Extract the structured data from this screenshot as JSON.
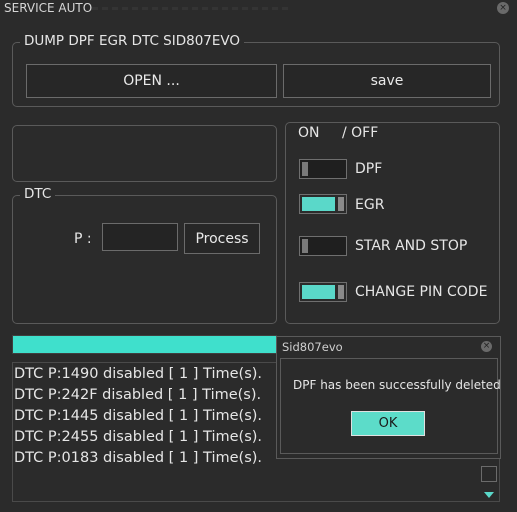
{
  "window": {
    "title": "SERVICE  AUTO"
  },
  "dump_group": {
    "legend": "DUMP   DPF   EGR   DTC   SID807EVO",
    "open_label": "OPEN ...",
    "save_label": "save"
  },
  "dtc_group": {
    "legend": "DTC",
    "p_label": "P :",
    "p_value": "",
    "process_label": "Process"
  },
  "onoff_group": {
    "on_label": "ON",
    "off_label": "/ OFF",
    "toggles": [
      {
        "label": "DPF",
        "state": "off"
      },
      {
        "label": "EGR",
        "state": "on"
      },
      {
        "label": "STAR AND STOP",
        "state": "off"
      },
      {
        "label": "CHANGE PIN CODE",
        "state": "on"
      }
    ]
  },
  "progress": {
    "value": 1.0,
    "color": "#3fe0cc"
  },
  "log": {
    "lines": [
      "DTC P:1490 disabled [ 1 ] Time(s).",
      "DTC P:242F disabled [ 1 ] Time(s).",
      "DTC P:1445 disabled [ 1 ] Time(s).",
      "DTC P:2455 disabled [ 1 ] Time(s).",
      "DTC P:0183 disabled [ 1 ] Time(s)."
    ]
  },
  "dialog": {
    "title": "Sid807evo",
    "message": "DPF has been successfully deleted",
    "ok_label": "OK"
  },
  "icons": {
    "close": "close-icon",
    "scroll_down": "chevron-down-icon"
  },
  "colors": {
    "accent": "#5ad8c9",
    "background": "#2b2b2b"
  }
}
